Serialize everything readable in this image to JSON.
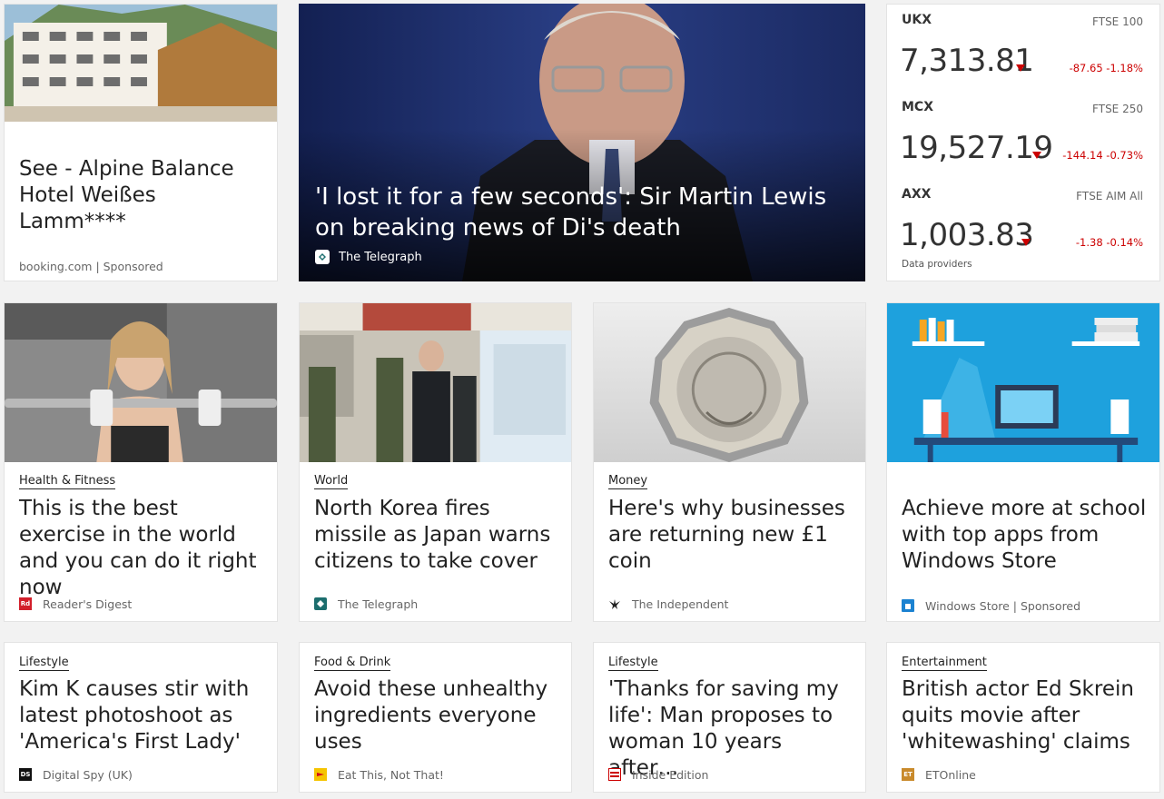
{
  "ad_card": {
    "title": "See - Alpine Balance Hotel Weißes Lamm****",
    "source": "booking.com | Sponsored"
  },
  "hero": {
    "title": "'I lost it for a few seconds': Sir Martin Lewis on breaking news of Di's death",
    "source": "The Telegraph"
  },
  "stocks": {
    "items": [
      {
        "code": "UKX",
        "index": "FTSE 100",
        "value": "7,313.81",
        "change": "-87.65  -1.18%"
      },
      {
        "code": "MCX",
        "index": "FTSE 250",
        "value": "19,527.19",
        "change": "-144.14  -0.73%"
      },
      {
        "code": "AXX",
        "index": "FTSE AIM All",
        "value": "1,003.83",
        "change": "-1.38  -0.14%"
      }
    ],
    "providers": "Data providers",
    "down_color": "#c00000"
  },
  "row2": [
    {
      "category": "Health & Fitness",
      "title": "This is the best exercise in the world and you can do it right now",
      "source": "Reader's Digest",
      "logo": "Rd"
    },
    {
      "category": "World",
      "title": "North Korea fires missile as Japan warns citizens to take cover",
      "source": "The Telegraph",
      "logo": ""
    },
    {
      "category": "Money",
      "title": "Here's why businesses are returning new £1 coin",
      "source": "The Independent",
      "logo": ""
    },
    {
      "category": "",
      "title": "Achieve more at school with top apps from Windows Store",
      "source": "Windows Store | Sponsored",
      "logo": ""
    }
  ],
  "row3": [
    {
      "category": "Lifestyle",
      "title": "Kim K causes stir with latest photoshoot as 'America's First Lady'",
      "source": "Digital Spy (UK)",
      "logo": "DS"
    },
    {
      "category": "Food & Drink",
      "title": "Avoid these unhealthy ingredients everyone uses",
      "source": "Eat This, Not That!",
      "logo": ""
    },
    {
      "category": "Lifestyle",
      "title": "'Thanks for saving my life': Man proposes to woman 10 years after…",
      "source": "Inside Edition",
      "logo": ""
    },
    {
      "category": "Entertainment",
      "title": "British actor Ed Skrein quits movie after 'whitewashing' claims",
      "source": "ETOnline",
      "logo": "ET"
    }
  ],
  "icons": {
    "telegraph": "telegraph-logo-icon",
    "independent": "eagle-icon",
    "windows_store": "store-bag-icon",
    "down_arrow": "down-triangle-icon"
  }
}
